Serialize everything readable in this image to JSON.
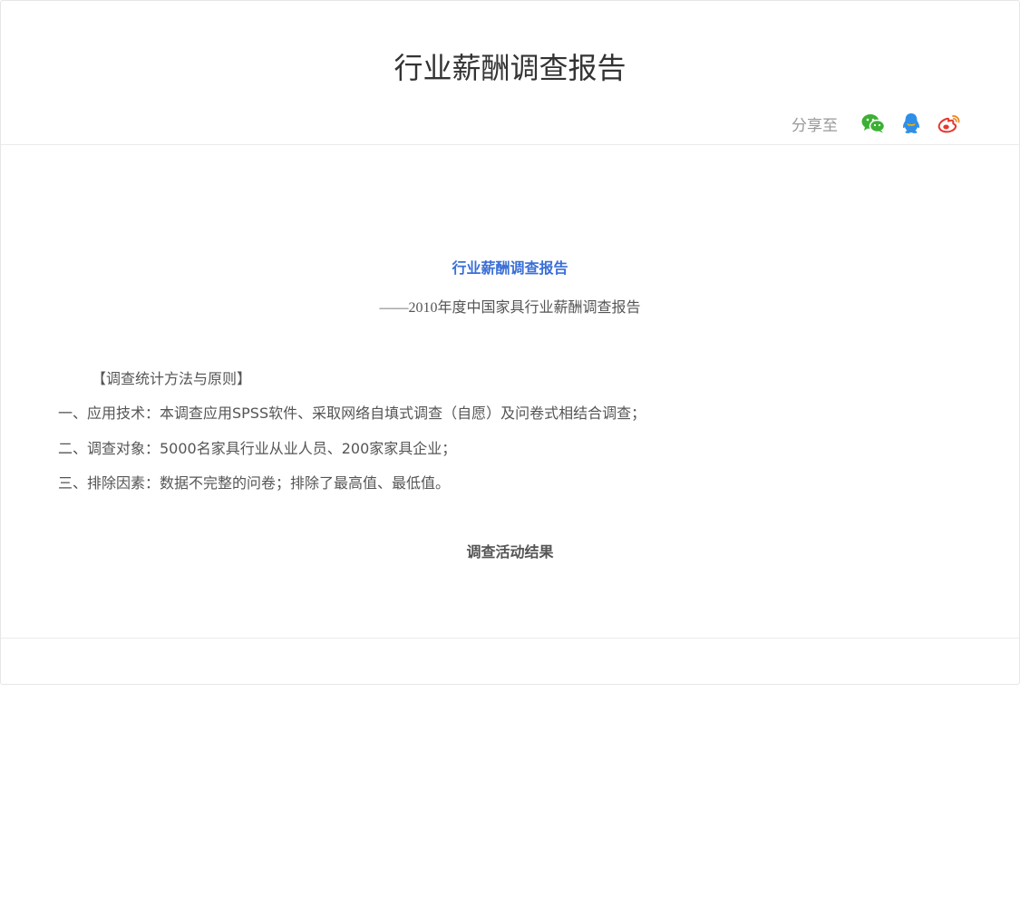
{
  "header": {
    "title": "行业薪酬调查报告",
    "share_label": "分享至",
    "share_targets": [
      {
        "name": "wechat",
        "icon": "wechat-icon",
        "color": "#3cb034"
      },
      {
        "name": "qq",
        "icon": "qq-icon",
        "color": "#2f8fe8"
      },
      {
        "name": "weibo",
        "icon": "weibo-icon",
        "color": "#e6372f"
      }
    ]
  },
  "article": {
    "title": "行业薪酬调查报告",
    "subtitle": "——2010年度中国家具行业薪酬调查报告",
    "section_heading": "【调查统计方法与原则】",
    "paragraphs": [
      "一、应用技术：本调查应用SPSS软件、采取网络自填式调查（自愿）及问卷式相结合调查；",
      "二、调查对象：5000名家具行业从业人员、200家家具企业；",
      "三、排除因素：数据不完整的问卷；排除了最高值、最低值。"
    ],
    "result_heading": "调查活动结果"
  },
  "colors": {
    "title_accent": "#3a6fd8",
    "text": "#555555",
    "muted": "#999999"
  }
}
